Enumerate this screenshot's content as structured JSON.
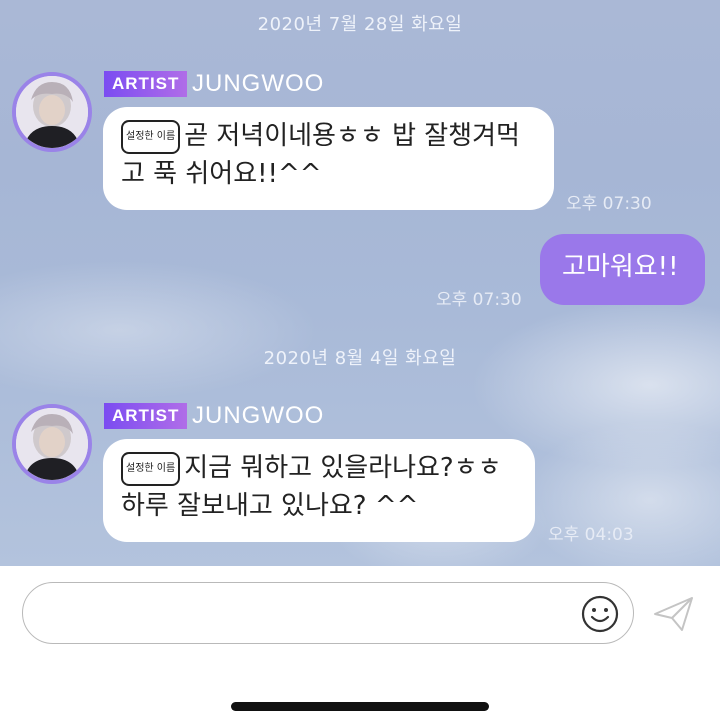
{
  "messages_group_1": {
    "date": "2020년 7월 28일 화요일",
    "badge": "ARTIST",
    "sender": "JUNGWOO",
    "name_tag": "설정한 이름",
    "line1": "곧 저녁이네용ㅎㅎ 밥 잘챙겨먹",
    "line2": "고 푹 쉬어요!!^^",
    "time": "오후 07:30",
    "reply": "고마워요!!",
    "reply_time": "오후 07:30"
  },
  "messages_group_2": {
    "date": "2020년 8월 4일 화요일",
    "badge": "ARTIST",
    "sender": "JUNGWOO",
    "name_tag": "설정한 이름",
    "line1": "지금 뭐하고 있을라나요?ㅎㅎ",
    "line2": "하루 잘보내고 있나요? ^^",
    "time": "오후 04:03"
  },
  "input": {
    "value": "",
    "placeholder": ""
  },
  "icons": {
    "emoji": "smiley-icon",
    "send": "send-icon"
  },
  "colors": {
    "accent": "#9a78ea",
    "badge_start": "#7b4cf1",
    "badge_end": "#b06de8",
    "avatar_ring": "#9a83e8"
  }
}
